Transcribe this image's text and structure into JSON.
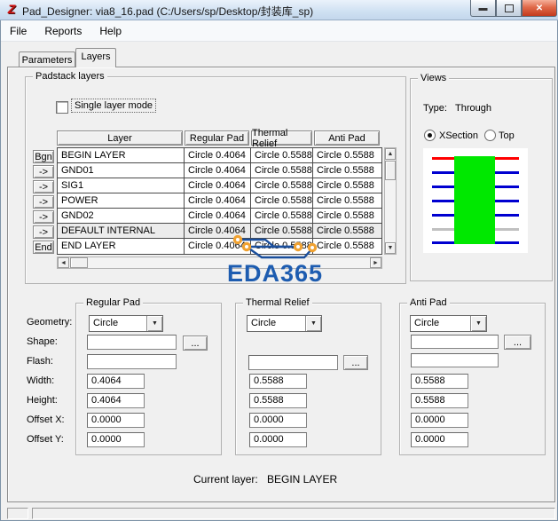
{
  "window": {
    "title": "Pad_Designer: via8_16.pad (C:/Users/sp/Desktop/封装库_sp)"
  },
  "menu": {
    "items": [
      "File",
      "Reports",
      "Help"
    ]
  },
  "tabs": {
    "parameters": "Parameters",
    "layers": "Layers",
    "active": "Layers"
  },
  "padstack": {
    "group_label": "Padstack layers",
    "single_layer_mode": {
      "label": "Single layer mode",
      "checked": false
    },
    "table": {
      "columns": [
        "Layer",
        "Regular Pad",
        "Thermal Relief",
        "Anti Pad"
      ],
      "row_buttons": [
        "Bgn",
        "->",
        "->",
        "->",
        "->",
        "->",
        "End"
      ],
      "rows": [
        {
          "layer": "BEGIN LAYER",
          "regular_pad": "Circle 0.4064",
          "thermal_relief": "Circle 0.5588",
          "anti_pad": "Circle 0.5588"
        },
        {
          "layer": "GND01",
          "regular_pad": "Circle 0.4064",
          "thermal_relief": "Circle 0.5588",
          "anti_pad": "Circle 0.5588"
        },
        {
          "layer": "SIG1",
          "regular_pad": "Circle 0.4064",
          "thermal_relief": "Circle 0.5588",
          "anti_pad": "Circle 0.5588"
        },
        {
          "layer": "POWER",
          "regular_pad": "Circle 0.4064",
          "thermal_relief": "Circle 0.5588",
          "anti_pad": "Circle 0.5588"
        },
        {
          "layer": "GND02",
          "regular_pad": "Circle 0.4064",
          "thermal_relief": "Circle 0.5588",
          "anti_pad": "Circle 0.5588"
        },
        {
          "layer": "DEFAULT INTERNAL",
          "regular_pad": "Circle 0.4064",
          "thermal_relief": "Circle 0.5588",
          "anti_pad": "Circle 0.5588"
        },
        {
          "layer": "END LAYER",
          "regular_pad": "Circle 0.4064",
          "thermal_relief": "Circle 0.5588",
          "anti_pad": "Circle 0.5588"
        }
      ]
    }
  },
  "views": {
    "group_label": "Views",
    "type_label": "Type:",
    "type_value": "Through",
    "xsection_label": "XSection",
    "top_label": "Top",
    "selected_view": "XSection",
    "layer_line_colors": [
      "#ff0000",
      "#0000d0",
      "#0000d0",
      "#0000d0",
      "#0000d0",
      "#c0c0c0",
      "#0000d0"
    ],
    "pad_color": "#00e800"
  },
  "field_labels": [
    "Geometry:",
    "Shape:",
    "Flash:",
    "Width:",
    "Height:",
    "Offset X:",
    "Offset Y:"
  ],
  "regular_pad": {
    "group_label": "Regular Pad",
    "geometry": "Circle",
    "shape": "",
    "flash": "",
    "width": "0.4064",
    "height": "0.4064",
    "offset_x": "0.0000",
    "offset_y": "0.0000",
    "browse_label": "..."
  },
  "thermal_relief": {
    "group_label": "Thermal Relief",
    "geometry": "Circle",
    "flash": "",
    "width": "0.5588",
    "height": "0.5588",
    "offset_x": "0.0000",
    "offset_y": "0.0000",
    "browse_label": "..."
  },
  "anti_pad": {
    "group_label": "Anti Pad",
    "geometry": "Circle",
    "shape": "",
    "flash": "",
    "width": "0.5588",
    "height": "0.5588",
    "offset_x": "0.0000",
    "offset_y": "0.0000",
    "browse_label": "..."
  },
  "footer": {
    "current_layer_label": "Current layer:",
    "current_layer_value": "BEGIN LAYER"
  },
  "watermark": {
    "text": "EDA365",
    "text_color": "#1d5cb0",
    "trace_color": "#1b4f9c",
    "pad_ring_color": "#f0a232"
  }
}
